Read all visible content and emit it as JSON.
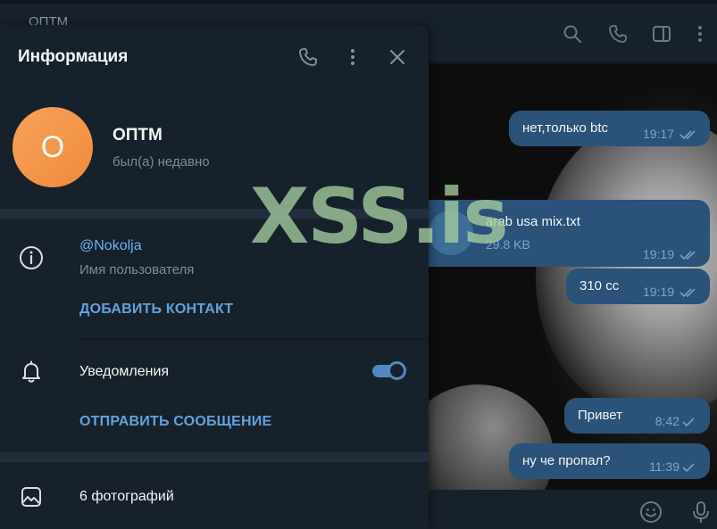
{
  "chat": {
    "title": "ОПТМ",
    "header_icons": [
      "search-icon",
      "phone-icon",
      "sidebar-toggle-icon",
      "more-vertical-icon"
    ],
    "messages": [
      {
        "text": "нет,только btc",
        "time": "19:17",
        "status": "read"
      },
      {
        "file_name": "arab usa mix.txt",
        "file_size": "29.8 KB",
        "time": "19:19",
        "status": "read"
      },
      {
        "text": "310 cc",
        "time": "19:19",
        "status": "read"
      },
      {
        "text": "Привет",
        "time": "8:42",
        "status": "sent"
      },
      {
        "text": "ну че пропал?",
        "time": "11:39",
        "status": "sent"
      }
    ],
    "input_icons": [
      "emoji-icon",
      "microphone-icon"
    ]
  },
  "info_panel": {
    "title": "Информация",
    "header_icons": [
      "phone-icon",
      "more-vertical-icon",
      "close-icon"
    ],
    "avatar_letter": "О",
    "avatar_color": "#f5954a",
    "name": "ОПТМ",
    "status": "был(а) недавно",
    "username": "@Nokolja",
    "username_label": "Имя пользователя",
    "add_contact": "ДОБАВИТЬ КОНТАКТ",
    "notifications_label": "Уведомления",
    "notifications_on": true,
    "send_message": "ОТПРАВИТЬ СООБЩЕНИЕ",
    "photos": "6 фотографий"
  },
  "watermark": "XSS.is",
  "colors": {
    "background": "#17212b",
    "bubble": "#2b5278",
    "accent": "#5288c1",
    "link": "#6ab3f3",
    "muted": "#7d8b99",
    "avatar": "#f5954a"
  }
}
